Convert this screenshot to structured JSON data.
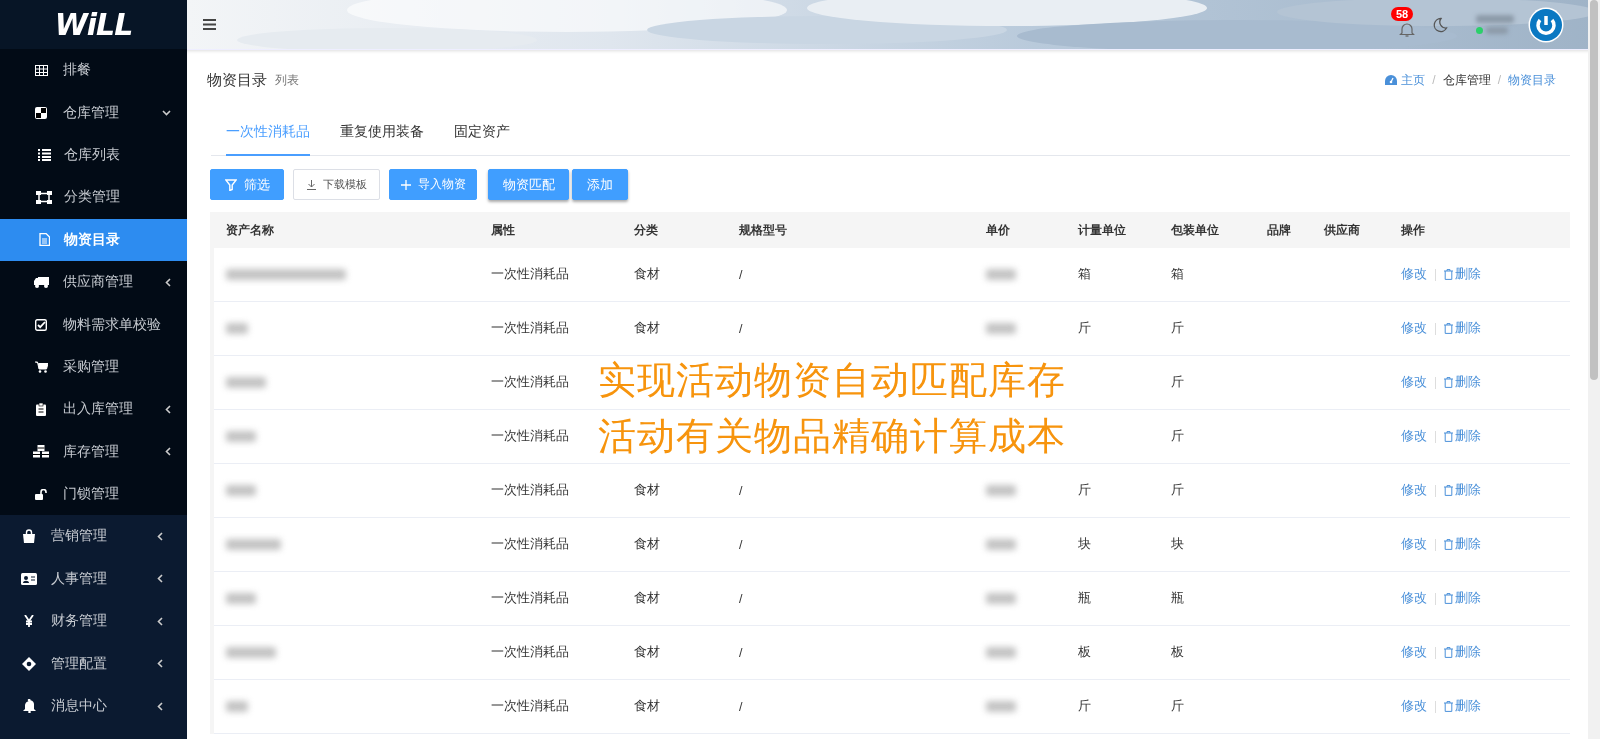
{
  "sidebar": {
    "logo_text": "WiLL",
    "submenu_items": [
      {
        "label": "排餐",
        "selected": false
      },
      {
        "label": "仓库管理",
        "selected": false,
        "expanded": true,
        "children": [
          {
            "label": "仓库列表",
            "selected": false
          },
          {
            "label": "分类管理",
            "selected": false
          },
          {
            "label": "物资目录",
            "selected": true
          }
        ]
      },
      {
        "label": "供应商管理",
        "selected": false,
        "expanded": false
      },
      {
        "label": "物料需求单校验",
        "selected": false
      },
      {
        "label": "采购管理",
        "selected": false
      },
      {
        "label": "出入库管理",
        "selected": false,
        "expanded": false
      },
      {
        "label": "库存管理",
        "selected": false,
        "expanded": false
      },
      {
        "label": "门锁管理",
        "selected": false
      }
    ],
    "items": [
      {
        "label": "营销管理",
        "selected": false,
        "expanded": false
      },
      {
        "label": "人事管理",
        "selected": false,
        "expanded": false
      },
      {
        "label": "财务管理",
        "selected": false,
        "expanded": false
      },
      {
        "label": "管理配置",
        "selected": false,
        "expanded": false
      },
      {
        "label": "消息中心",
        "selected": false,
        "expanded": false
      }
    ]
  },
  "header": {
    "notification_count": "58"
  },
  "page": {
    "title": "物资目录",
    "subtitle": "列表",
    "breadcrumb": [
      {
        "label": "主页"
      },
      {
        "separator": "/",
        "label": "仓库管理"
      },
      {
        "separator": "/",
        "label": "物资目录"
      }
    ]
  },
  "tabs": [
    {
      "label": "一次性消耗品",
      "selected": true
    },
    {
      "label": "重复使用装备",
      "selected": false
    },
    {
      "label": "固定资产",
      "selected": false
    }
  ],
  "buttons": [
    {
      "label": "筛选",
      "kind": "primary"
    },
    {
      "label": "下载模板",
      "kind": "default"
    },
    {
      "label": "导入物资",
      "kind": "primary"
    },
    {
      "label": "物资匹配",
      "kind": "primary"
    },
    {
      "label": "添加",
      "kind": "primary"
    }
  ],
  "table": {
    "columns": [
      "资产名称",
      "属性",
      "分类",
      "规格型号",
      "单价",
      "计量单位",
      "包装单位",
      "品牌",
      "供应商",
      "操作"
    ],
    "rows": [
      {
        "attribute": "一次性消耗品",
        "category": "食材",
        "spec": "/",
        "unit": "箱",
        "package": "箱",
        "actions": [
          "修改",
          "删除"
        ]
      },
      {
        "attribute": "一次性消耗品",
        "category": "食材",
        "spec": "/",
        "unit": "斤",
        "package": "斤",
        "actions": [
          "修改",
          "删除"
        ]
      },
      {
        "attribute": "一次性消耗品",
        "package": "斤",
        "actions": [
          "修改",
          "删除"
        ]
      },
      {
        "attribute": "一次性消耗品",
        "package": "斤",
        "actions": [
          "修改",
          "删除"
        ]
      },
      {
        "attribute": "一次性消耗品",
        "category": "食材",
        "spec": "/",
        "unit": "斤",
        "package": "斤",
        "actions": [
          "修改",
          "删除"
        ]
      },
      {
        "attribute": "一次性消耗品",
        "category": "食材",
        "spec": "/",
        "unit": "块",
        "package": "块",
        "actions": [
          "修改",
          "删除"
        ]
      },
      {
        "attribute": "一次性消耗品",
        "category": "食材",
        "spec": "/",
        "unit": "瓶",
        "package": "瓶",
        "actions": [
          "修改",
          "删除"
        ]
      },
      {
        "attribute": "一次性消耗品",
        "category": "食材",
        "spec": "/",
        "unit": "板",
        "package": "板",
        "actions": [
          "修改",
          "删除"
        ]
      },
      {
        "attribute": "一次性消耗品",
        "category": "食材",
        "spec": "/",
        "unit": "斤",
        "package": "斤",
        "actions": [
          "修改",
          "删除"
        ]
      }
    ]
  },
  "overlay_caption": [
    "实现活动物资自动匹配库存",
    "活动有关物品精确计算成本"
  ]
}
